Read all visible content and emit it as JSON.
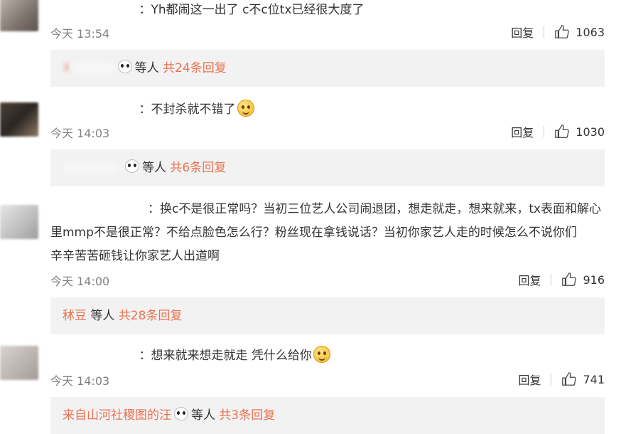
{
  "comments": [
    {
      "text": "Yh都闹这一出了  c不c位tx已经很大度了",
      "time": "今天 13:54",
      "reply_label": "回复",
      "likes": "1063",
      "replies": {
        "user": "X",
        "suffix": "等人",
        "total": "共24条回复"
      }
    },
    {
      "text": "不封杀就不错了",
      "time": "今天 14:03",
      "reply_label": "回复",
      "likes": "1030",
      "replies": {
        "user": "",
        "suffix": "等人",
        "total": "共6条回复"
      }
    },
    {
      "text_lines": [
        "换c不是很正常吗？当初三位艺人公司闹退团，想走就走，想来就来，tx表面和解心",
        "里mmp不是很正常？不给点脸色怎么行？粉丝现在拿钱说话？当初你家艺人走的时候怎么不说你们",
        "辛辛苦苦砸钱让你家艺人出道啊"
      ],
      "time": "今天 14:00",
      "reply_label": "回复",
      "likes": "916",
      "replies": {
        "user": "秫豆",
        "suffix": "等人",
        "total": "共28条回复"
      }
    },
    {
      "text": "想来就来想走就走 凭什么给你",
      "time": "今天 14:03",
      "reply_label": "回复",
      "likes": "741",
      "replies": {
        "user": "来自山河社稷图的汪",
        "suffix": "等人",
        "total": "共3条回复"
      }
    }
  ],
  "icons": {
    "like": "thumbs-up-icon",
    "emoji": "smiley-emoji-icon",
    "panda": "panda-emoji-icon"
  },
  "colors": {
    "link": "#eb7350",
    "muted": "#808080",
    "reply_bg": "#f2f2f2"
  }
}
